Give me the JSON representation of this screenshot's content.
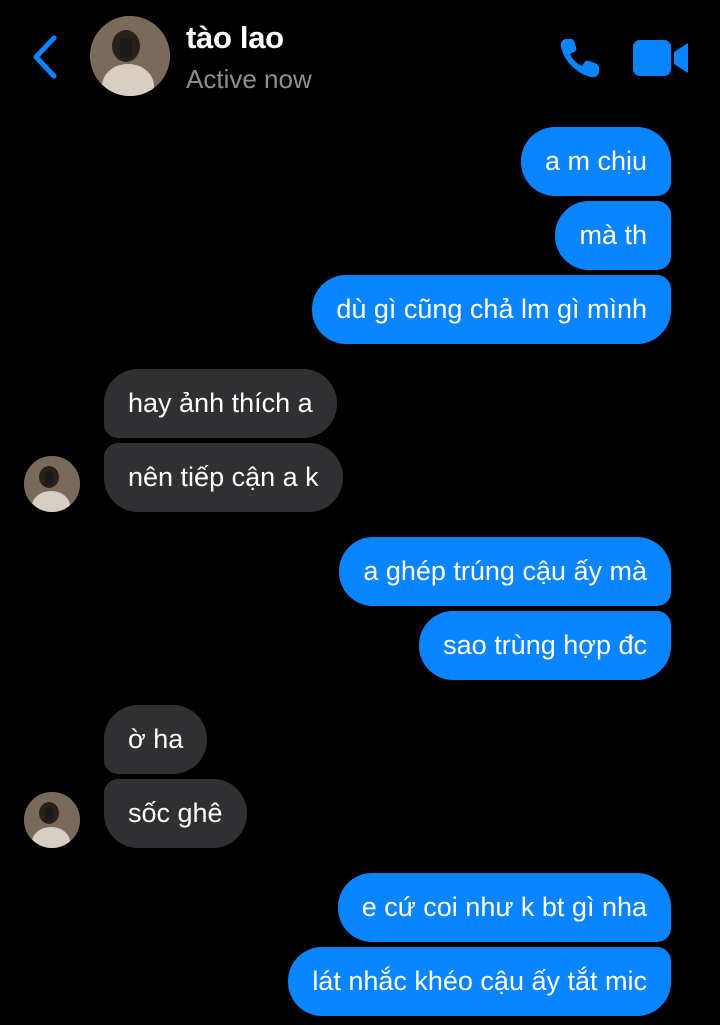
{
  "header": {
    "name": "tào lao",
    "status": "Active now",
    "icons": {
      "back": "chevron-left-icon",
      "call": "phone-icon",
      "video": "video-camera-icon"
    },
    "accent": "#0a84ff"
  },
  "messages": [
    {
      "from": "me",
      "text": "a m chịu"
    },
    {
      "from": "me",
      "text": "mà th"
    },
    {
      "from": "me",
      "text": "dù gì cũng chả lm gì mình"
    },
    {
      "from": "them",
      "text": "hay ảnh thích a"
    },
    {
      "from": "them",
      "text": "nên tiếp cận a k"
    },
    {
      "from": "me",
      "text": "a ghép trúng cậu ấy mà"
    },
    {
      "from": "me",
      "text": "sao trùng hợp đc"
    },
    {
      "from": "them",
      "text": "ờ ha"
    },
    {
      "from": "them",
      "text": "sốc ghê"
    },
    {
      "from": "me",
      "text": "e cứ coi như k bt gì nha"
    },
    {
      "from": "me",
      "text": "lát nhắc khéo cậu ấy tắt mic"
    }
  ],
  "colors": {
    "outgoing": "#0a84ff",
    "incoming": "#303032",
    "background": "#000000",
    "status": "#8e8e93"
  }
}
